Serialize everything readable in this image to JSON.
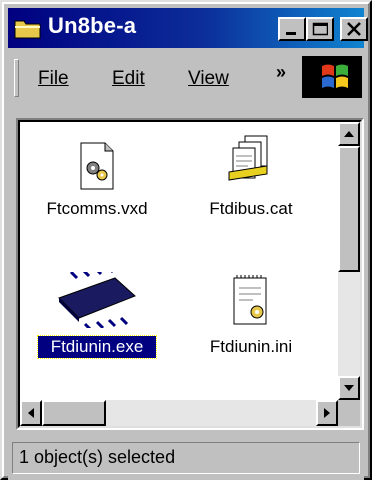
{
  "window": {
    "title": "Un8be-a"
  },
  "menu": [
    {
      "id": "file",
      "label": "File"
    },
    {
      "id": "edit",
      "label": "Edit"
    },
    {
      "id": "view",
      "label": "View"
    }
  ],
  "toolbar": {
    "overflow_label": "»"
  },
  "files": [
    {
      "name": "Ftcomms.vxd",
      "icon": "system-file-icon",
      "selected": false
    },
    {
      "name": "Ftdibus.cat",
      "icon": "catalog-file-icon",
      "selected": false
    },
    {
      "name": "Ftdiunin.exe",
      "icon": "chip-exe-icon",
      "selected": true
    },
    {
      "name": "Ftdiunin.ini",
      "icon": "ini-settings-icon",
      "selected": false
    }
  ],
  "status": {
    "text": "1 object(s) selected"
  },
  "colors": {
    "titlebar_start": "#000080",
    "titlebar_end": "#1084d0",
    "selection": "#000080",
    "face": "#c0c0c0"
  }
}
